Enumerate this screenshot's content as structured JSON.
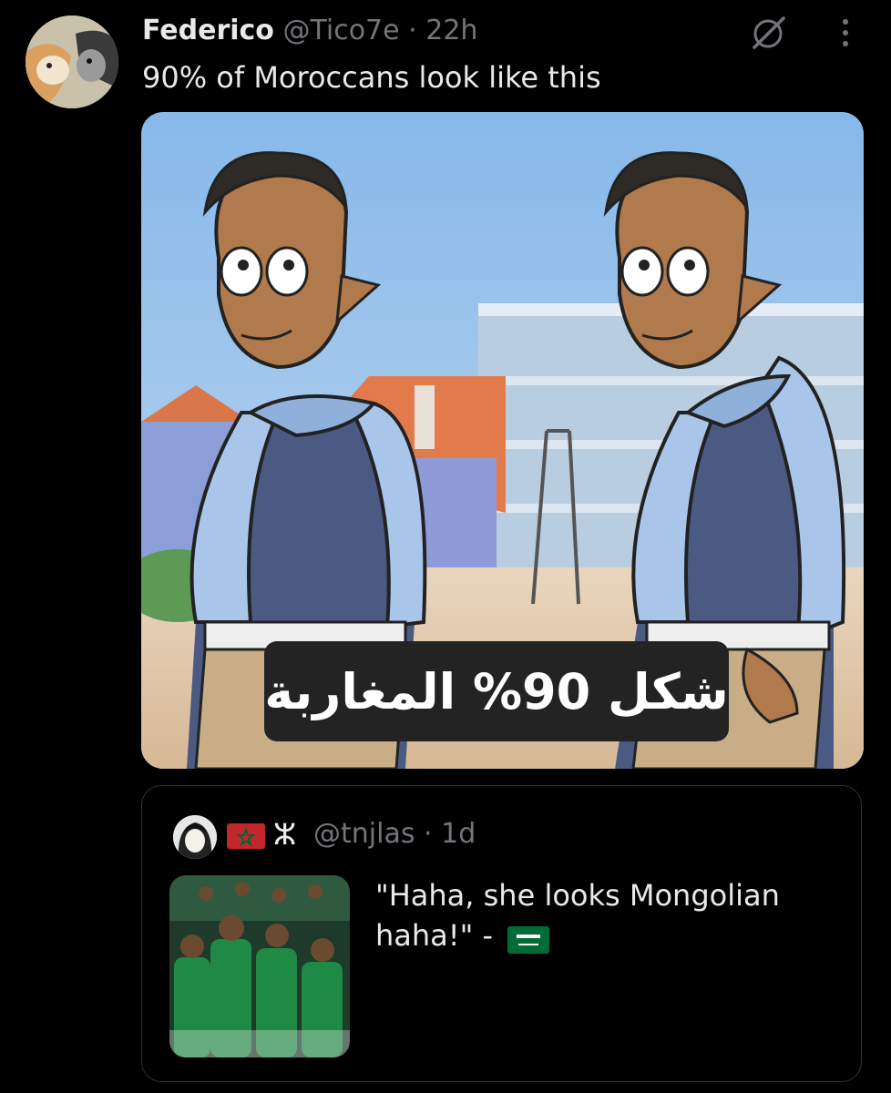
{
  "tweet": {
    "author_name": "Federico",
    "handle": "@Tico7e",
    "separator": "·",
    "time": "22h",
    "text": "90% of Moroccans look like this",
    "media_caption": "شكل 90% المغاربة",
    "icons": [
      "grok-icon",
      "more-icon"
    ]
  },
  "quoted": {
    "flag_icon": "morocco-flag-icon",
    "glyph": "ⵣ",
    "handle": "@tnjlas",
    "separator": "·",
    "time": "1d",
    "text": "\"Haha, she looks Mongolian haha!\" -",
    "trailing_flag_icon": "saudi-flag-icon"
  },
  "colors": {
    "background": "#000000",
    "text": "#e7e9ea",
    "muted": "#71767b",
    "border": "#2f3336"
  }
}
